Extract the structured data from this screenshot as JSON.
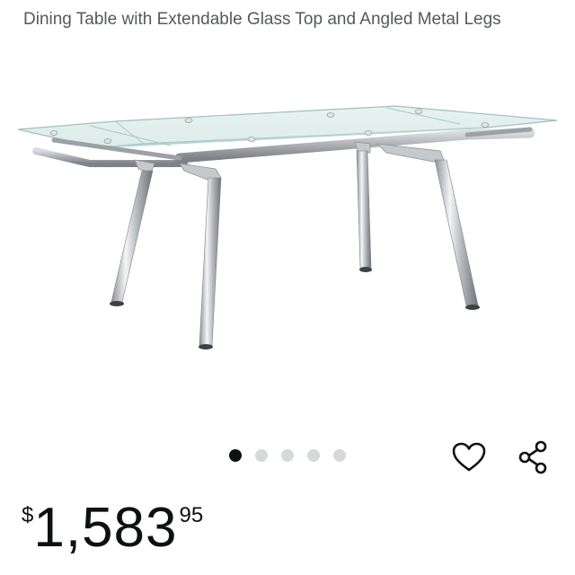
{
  "product": {
    "title": "Dining Table with Extendable Glass Top and Angled Metal Legs"
  },
  "gallery": {
    "image_count": 5,
    "active_index": 0
  },
  "actions": {
    "wishlist_icon": "heart-outline-icon",
    "share_icon": "share-icon"
  },
  "price": {
    "symbol": "$",
    "whole": "1,583",
    "fraction": "95"
  }
}
